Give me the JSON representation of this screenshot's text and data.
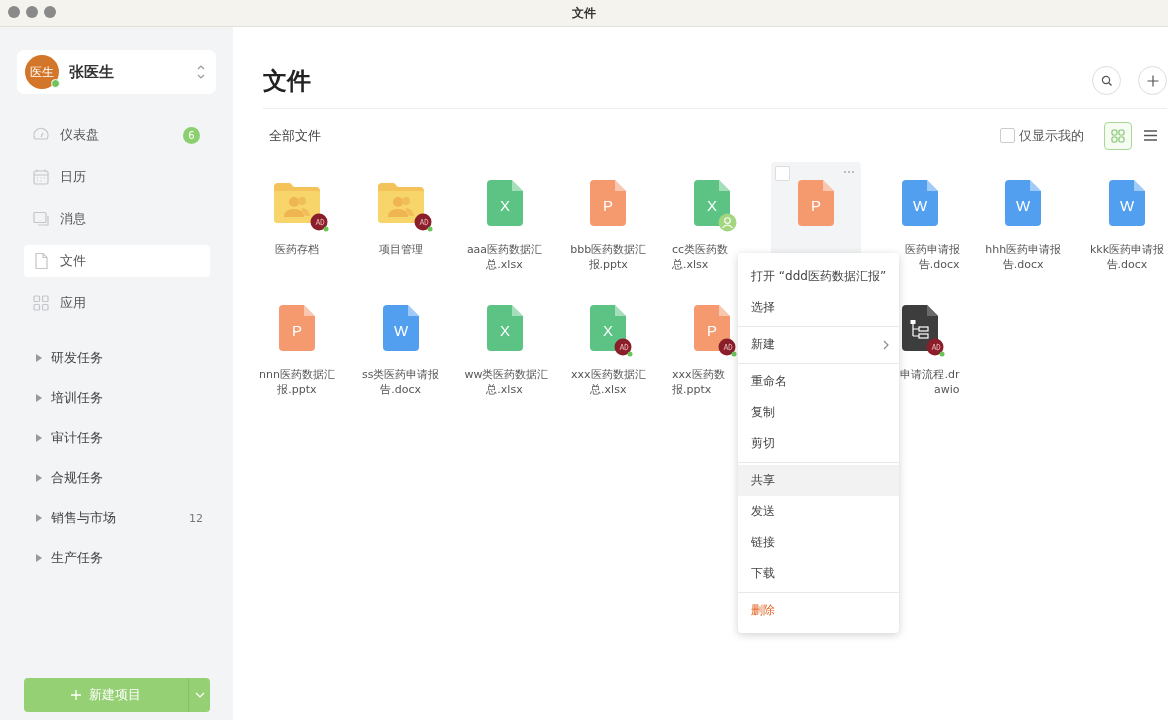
{
  "window": {
    "title": "文件"
  },
  "sidebar": {
    "account": {
      "avatar": "医生",
      "name": "张医生",
      "online": true
    },
    "nav": [
      {
        "label": "仪表盘",
        "badge": "6",
        "selected": false
      },
      {
        "label": "日历",
        "selected": false
      },
      {
        "label": "消息",
        "selected": false
      },
      {
        "label": "文件",
        "selected": true
      },
      {
        "label": "应用",
        "selected": false
      }
    ],
    "groups": [
      {
        "label": "研发任务",
        "expanded": false
      },
      {
        "label": "培训任务",
        "expanded": false
      },
      {
        "label": "审计任务",
        "expanded": false
      },
      {
        "label": "合规任务",
        "expanded": false
      },
      {
        "label": "销售与市场",
        "expanded": false,
        "count": "12"
      },
      {
        "label": "生产任务",
        "expanded": false
      }
    ],
    "new_button": "新建项目"
  },
  "main": {
    "title": "文件",
    "breadcrumb": "全部文件",
    "only_mine": {
      "label": "仅显示我的",
      "checked": false
    },
    "grid_view": true,
    "files": [
      {
        "kind": "folder",
        "lines": [
          "医药存档"
        ],
        "owner_badge": true,
        "selected": false
      },
      {
        "kind": "folder",
        "lines": [
          "项目管理"
        ],
        "owner_badge": true,
        "selected": false
      },
      {
        "kind": "xlsx",
        "glyph": "X",
        "lines": [
          "aaa医药数据汇",
          "总.xlsx"
        ],
        "selected": false
      },
      {
        "kind": "pptx",
        "glyph": "P",
        "lines": [
          "bbb医药数据汇",
          "报.pptx"
        ],
        "selected": false
      },
      {
        "kind": "xlsx",
        "glyph": "X",
        "lines": [
          "cc类医药数",
          "总.xlsx"
        ],
        "shared_badge": true,
        "cut_at_end": true,
        "selected": false
      },
      {
        "kind": "pptx",
        "glyph": "P",
        "selected": true
      },
      {
        "kind": "docx",
        "glyph": "W",
        "lines": [
          "医药申请报",
          "告.docx"
        ],
        "cut_at_start": true,
        "selected": false
      },
      {
        "kind": "docx",
        "glyph": "W",
        "lines": [
          "hhh医药申请报",
          "告.docx"
        ],
        "selected": false
      },
      {
        "kind": "docx",
        "glyph": "W",
        "lines": [
          "kkk医药申请报",
          "告.docx"
        ],
        "selected": false
      },
      {
        "kind": "pptx",
        "glyph": "P",
        "lines": [
          "nnn医药数据汇",
          "报.pptx"
        ],
        "selected": false
      },
      {
        "kind": "docx",
        "glyph": "W",
        "lines": [
          "ss类医药申请报",
          "告.docx"
        ],
        "selected": false
      },
      {
        "kind": "xlsx",
        "glyph": "X",
        "lines": [
          "ww类医药数据汇",
          "总.xlsx"
        ],
        "selected": false
      },
      {
        "kind": "xlsx",
        "glyph": "X",
        "lines": [
          "xxx医药数据汇",
          "总.xlsx"
        ],
        "owner_badge": true,
        "selected": false
      },
      {
        "kind": "pptx",
        "glyph": "P",
        "lines": [
          "xxx医药数",
          "报.pptx"
        ],
        "owner_badge": true,
        "cut_at_end": true,
        "selected": false
      },
      {
        "kind": "drawio",
        "lines": [
          "申请流程.dr",
          "awio"
        ],
        "owner_badge": true,
        "cut_at_start": true,
        "selected": false
      }
    ]
  },
  "context_menu": [
    [
      {
        "label": "打开 “ddd医药数据汇报”",
        "kind": "normal",
        "highlighted": false
      },
      {
        "label": "选择",
        "kind": "normal",
        "highlighted": false
      }
    ],
    [
      {
        "label": "新建",
        "kind": "submenu",
        "highlighted": false
      }
    ],
    [
      {
        "label": "重命名",
        "kind": "normal",
        "highlighted": false
      },
      {
        "label": "复制",
        "kind": "normal",
        "highlighted": false
      },
      {
        "label": "剪切",
        "kind": "normal",
        "highlighted": false
      }
    ],
    [
      {
        "label": "共享",
        "kind": "normal",
        "highlighted": true
      },
      {
        "label": "发送",
        "kind": "normal",
        "highlighted": false
      },
      {
        "label": "链接",
        "kind": "normal",
        "highlighted": false
      },
      {
        "label": "下载",
        "kind": "normal",
        "highlighted": false
      }
    ],
    [
      {
        "label": "删除",
        "kind": "danger",
        "highlighted": false
      }
    ]
  ]
}
